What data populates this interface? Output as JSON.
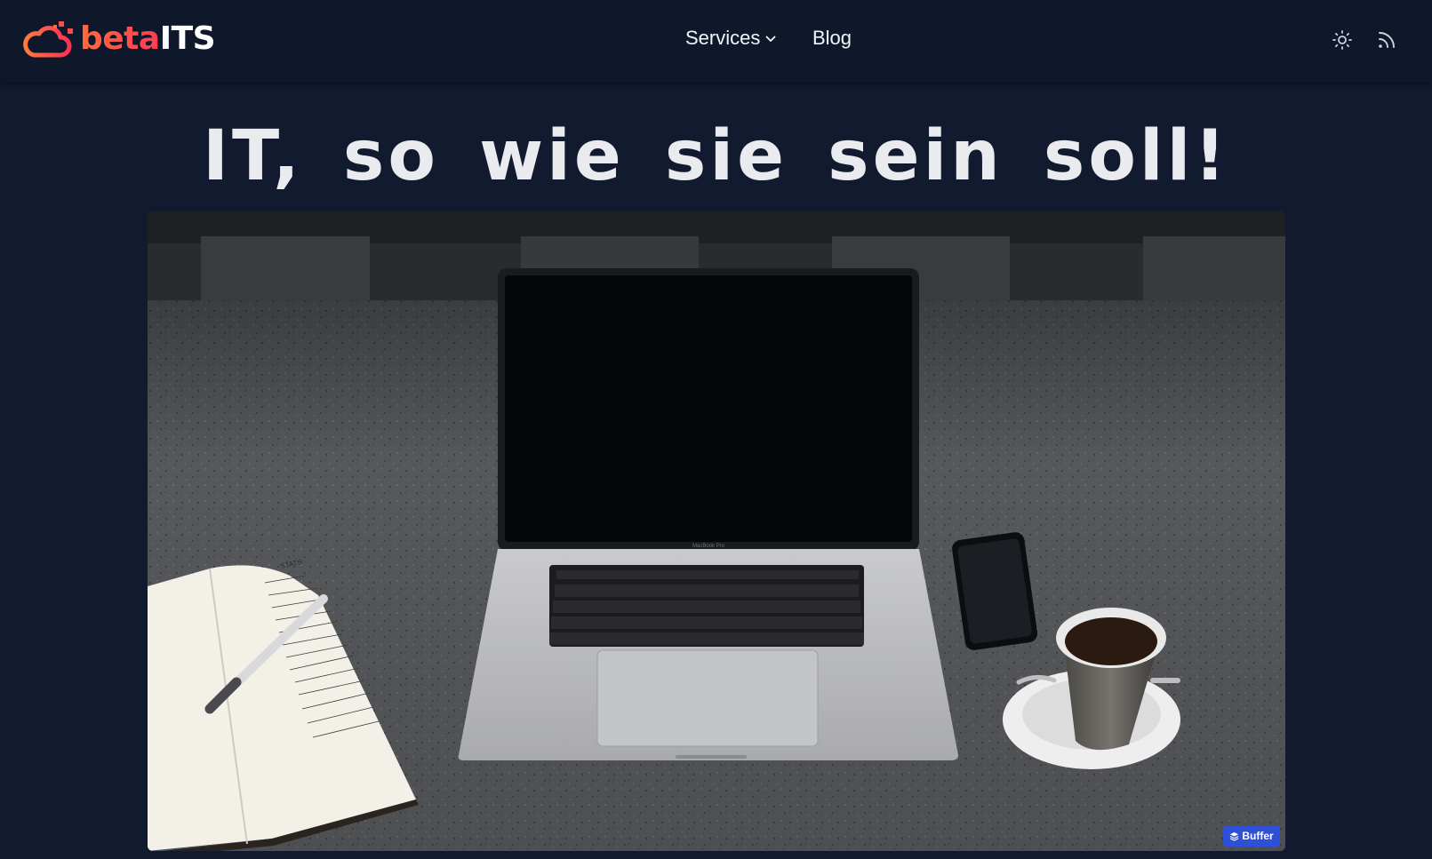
{
  "header": {
    "logo": {
      "beta": "beta",
      "its": "ITS",
      "icon": "cloud-logo-icon"
    },
    "nav": [
      {
        "label": "Services",
        "has_dropdown": true
      },
      {
        "label": "Blog",
        "has_dropdown": false
      }
    ],
    "actions": [
      {
        "icon": "sun-icon"
      },
      {
        "icon": "rss-icon"
      }
    ]
  },
  "hero": {
    "title": "IT, so wie sie sein soll!",
    "image": {
      "laptop_label": "MacBook Pro",
      "notebook_heading": "STATS"
    }
  },
  "buffer": {
    "label": "Buffer",
    "icon": "buffer-icon"
  },
  "colors": {
    "background": "#111a2e",
    "navbar": "#0f172a",
    "brand_gradient_start": "#ff6a3d",
    "brand_gradient_end": "#ff3d55",
    "buffer_blue": "#2f4fd6"
  }
}
